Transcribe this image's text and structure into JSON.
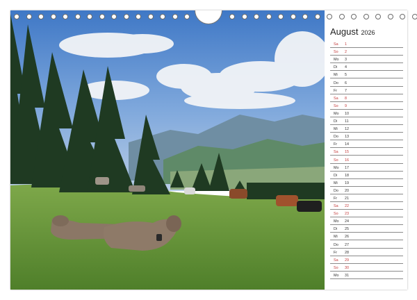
{
  "calendar": {
    "month": "August",
    "year": "2026",
    "days": [
      {
        "wd": "Sa",
        "d": "1",
        "we": true
      },
      {
        "wd": "So",
        "d": "2",
        "we": true
      },
      {
        "wd": "Mo",
        "d": "3",
        "we": false
      },
      {
        "wd": "Di",
        "d": "4",
        "we": false
      },
      {
        "wd": "Mi",
        "d": "5",
        "we": false
      },
      {
        "wd": "Do",
        "d": "6",
        "we": false
      },
      {
        "wd": "Fr",
        "d": "7",
        "we": false
      },
      {
        "wd": "Sa",
        "d": "8",
        "we": true
      },
      {
        "wd": "So",
        "d": "9",
        "we": true
      },
      {
        "wd": "Mo",
        "d": "10",
        "we": false
      },
      {
        "wd": "Di",
        "d": "11",
        "we": false
      },
      {
        "wd": "Mi",
        "d": "12",
        "we": false
      },
      {
        "wd": "Do",
        "d": "13",
        "we": false
      },
      {
        "wd": "Fr",
        "d": "14",
        "we": false
      },
      {
        "wd": "Sa",
        "d": "15",
        "we": true
      },
      {
        "wd": "So",
        "d": "16",
        "we": true
      },
      {
        "wd": "Mo",
        "d": "17",
        "we": false
      },
      {
        "wd": "Di",
        "d": "18",
        "we": false
      },
      {
        "wd": "Mi",
        "d": "19",
        "we": false
      },
      {
        "wd": "Do",
        "d": "20",
        "we": false
      },
      {
        "wd": "Fr",
        "d": "21",
        "we": false
      },
      {
        "wd": "Sa",
        "d": "22",
        "we": true
      },
      {
        "wd": "So",
        "d": "23",
        "we": true
      },
      {
        "wd": "Mo",
        "d": "24",
        "we": false
      },
      {
        "wd": "Di",
        "d": "25",
        "we": false
      },
      {
        "wd": "Mi",
        "d": "26",
        "we": false
      },
      {
        "wd": "Do",
        "d": "27",
        "we": false
      },
      {
        "wd": "Fr",
        "d": "28",
        "we": false
      },
      {
        "wd": "Sa",
        "d": "29",
        "we": true
      },
      {
        "wd": "So",
        "d": "30",
        "we": true
      },
      {
        "wd": "Mo",
        "d": "31",
        "we": false
      }
    ]
  },
  "colors": {
    "weekend": "#c43b3b",
    "text": "#333333",
    "rule": "#8a8a8a"
  },
  "photo": {
    "subject": "alpine-pasture-with-cows"
  }
}
